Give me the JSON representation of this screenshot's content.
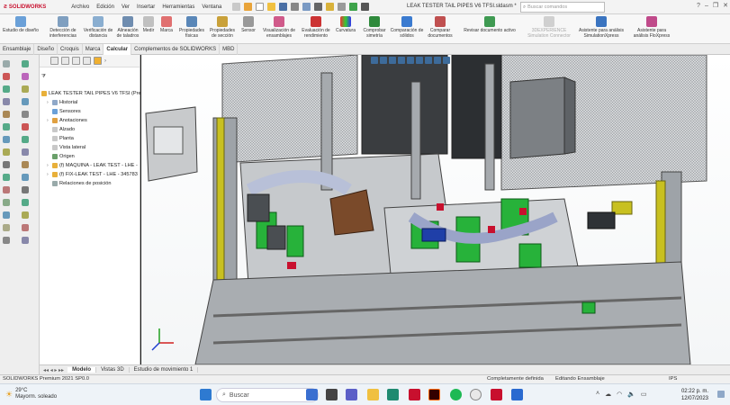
{
  "app": {
    "logo": "SOLIDWORKS",
    "menu": [
      "Archivo",
      "Edición",
      "Ver",
      "Insertar",
      "Herramientas",
      "Ventana"
    ],
    "document_title": "LEAK TESTER TAIL PIPES V6 TFSI.sldasm *",
    "search_placeholder": "Buscar comandos"
  },
  "ribbon": {
    "buttons": [
      {
        "label": "Estudio de diseño",
        "icon": "design-study-icon"
      },
      {
        "label": "Detección de interferencias",
        "icon": "interference-icon"
      },
      {
        "label": "Verificación de distancia",
        "icon": "clearance-icon"
      },
      {
        "label": "Alineación de taladros",
        "icon": "hole-align-icon"
      },
      {
        "label": "Medir",
        "icon": "measure-icon"
      },
      {
        "label": "Marca",
        "icon": "markup-icon"
      },
      {
        "label": "Propiedades físicas",
        "icon": "mass-props-icon"
      },
      {
        "label": "Propiedades de sección",
        "icon": "section-props-icon"
      },
      {
        "label": "Sensor",
        "icon": "sensor-icon"
      },
      {
        "label": "Visualización de ensamblajes",
        "icon": "assembly-vis-icon"
      },
      {
        "label": "Evaluación de rendimiento",
        "icon": "performance-icon"
      },
      {
        "label": "Curvatura",
        "icon": "curvature-icon"
      },
      {
        "label": "Comprobar simetría",
        "icon": "symmetry-icon"
      },
      {
        "label": "Comparación de sólidos",
        "icon": "compare-bodies-icon"
      },
      {
        "label": "Comparar documentos",
        "icon": "compare-docs-icon"
      },
      {
        "label": "Revisar documento activo",
        "icon": "check-active-icon"
      },
      {
        "label": "3DEXPERIENCE Simulation Connector",
        "icon": "3dx-icon"
      },
      {
        "label": "Asistente para análisis SimulationXpress",
        "icon": "simxpress-icon"
      },
      {
        "label": "Asistente para análisis FloXpress",
        "icon": "floxpress-icon"
      }
    ]
  },
  "command_tabs": [
    "Ensamblaje",
    "Diseño",
    "Croquis",
    "Marca",
    "Calcular",
    "Complementos de SOLIDWORKS",
    "MBD"
  ],
  "command_tab_active": "Calcular",
  "tree": {
    "root": "LEAK TESTER TAIL PIPES V6 TFSI (Pre",
    "items": [
      "Historial",
      "Sensores",
      "Anotaciones",
      "Alzado",
      "Planta",
      "Vista lateral",
      "Origen",
      "(f) MAQUINA - LEAK TEST - LHE -",
      "(f) FIX-LEAK TEST - LHE - 345783",
      "Relaciones de posición"
    ]
  },
  "bottom_tabs": [
    "Modelo",
    "Vistas 3D",
    "Estudio de movimiento 1"
  ],
  "bottom_tab_active": "Modelo",
  "status": {
    "left": "SOLIDWORKS Premium 2021 SP0.0",
    "definition": "Completamente definida",
    "mode": "Editando Ensamblaje",
    "units": "IPS"
  },
  "taskbar": {
    "temp": "29°C",
    "weather": "Mayorm. soleado",
    "search": "Buscar",
    "time": "02:22 p. m.",
    "date": "12/07/2023"
  },
  "colors": {
    "accent": "#c8102e",
    "machine_green": "#27b23a",
    "machine_yellow": "#c8c020",
    "frame_gray": "#b0b4b8"
  }
}
